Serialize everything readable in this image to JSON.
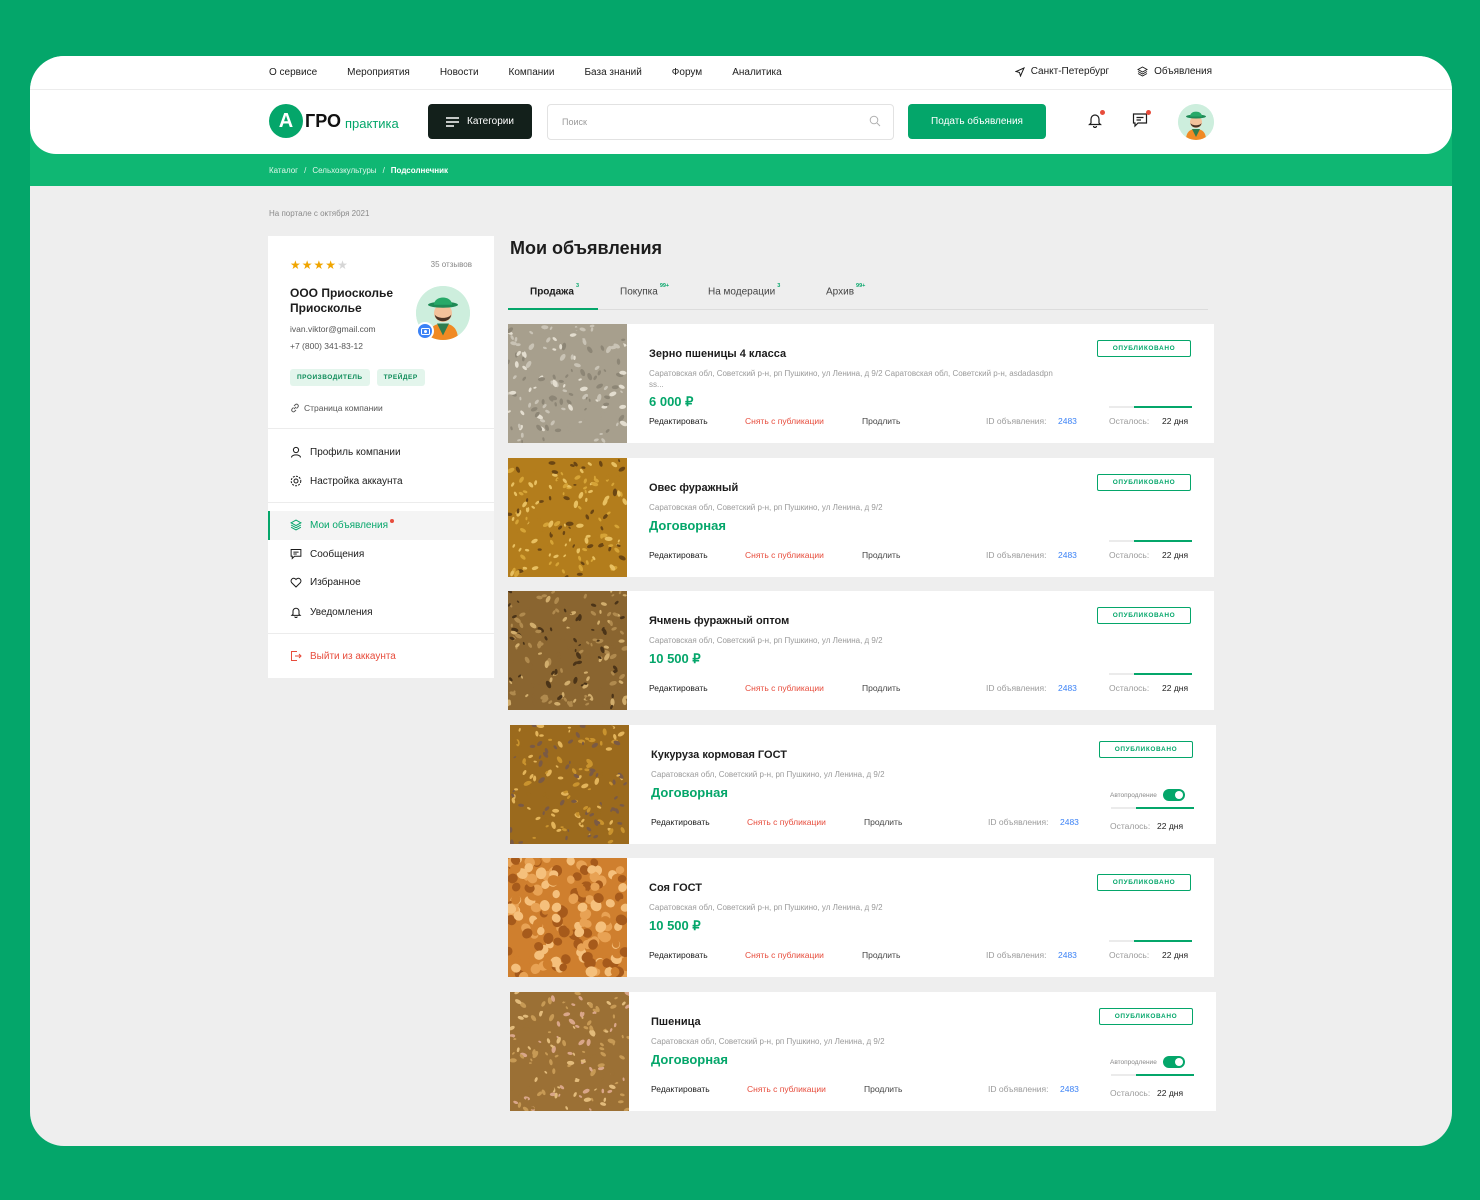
{
  "topnav": [
    "О сервисе",
    "Мероприятия",
    "Новости",
    "Компании",
    "База знаний",
    "Форум",
    "Аналитика"
  ],
  "topright": {
    "city": "Санкт-Петербург",
    "ads": "Объявления"
  },
  "logo": {
    "mark": "А",
    "main": "ГРО",
    "sub": "практика"
  },
  "header": {
    "categories_label": "Категории",
    "search_placeholder": "Поиск",
    "post_label": "Подать объявления"
  },
  "breadcrumb": [
    "Каталог",
    "Сельхозкультуры",
    "Подсолнечник"
  ],
  "since": "На портале с октября 2021",
  "profile": {
    "rating": 4,
    "reviews": "35 отзывов",
    "company": "ООО Приосколье Приосколье",
    "email": "ivan.viktor@gmail.com",
    "phone": "+7 (800) 341-83-12",
    "tags": [
      "ПРОИЗВОДИТЕЛЬ",
      "ТРЕЙДЕР"
    ],
    "company_link": "Страница компании"
  },
  "menu": {
    "profile": "Профиль компании",
    "settings": "Настройка аккаунта",
    "ads": "Мои объявления",
    "messages": "Сообщения",
    "favorites": "Избранное",
    "notifications": "Уведомления",
    "logout": "Выйти из аккаунта"
  },
  "main": {
    "title": "Мои объявления",
    "tabs": [
      {
        "label": "Продажа",
        "count": "3"
      },
      {
        "label": "Покупка",
        "count": "99+"
      },
      {
        "label": "На модерации",
        "count": "3"
      },
      {
        "label": "Архив",
        "count": "99+"
      }
    ]
  },
  "card_labels": {
    "edit": "Редактировать",
    "unpublish": "Снять с публикации",
    "extend": "Продлить",
    "id_label": "ID объявления:",
    "left_label": "Осталось:",
    "status": "ОПУБЛИКОВАНО",
    "autorenew": "Автопродление"
  },
  "listings": [
    {
      "name": "Зерно пшеницы 4 класса",
      "address": "Саратовская обл, Советский р-н, рп Пушкино, ул Ленина, д 9/2 Саратовская обл, Советский р-н, asdadasdpn ss...",
      "price": "6 000 ₽",
      "id": "2483",
      "left": "22 дня",
      "progress": 0.7,
      "autorenew": false
    },
    {
      "name": "Овес фуражный",
      "address": "Саратовская обл, Советский р-н, рп Пушкино, ул Ленина, д 9/2",
      "price": "Договорная",
      "id": "2483",
      "left": "22 дня",
      "progress": 0.7,
      "autorenew": false
    },
    {
      "name": "Ячмень фуражный оптом",
      "address": "Саратовская обл, Советский р-н, рп Пушкино, ул Ленина, д 9/2",
      "price": "10 500 ₽",
      "id": "2483",
      "left": "22 дня",
      "progress": 0.7,
      "autorenew": false
    },
    {
      "name": "Кукуруза кормовая ГОСТ",
      "address": "Саратовская обл, Советский р-н, рп Пушкино, ул Ленина, д 9/2",
      "price": "Договорная",
      "id": "2483",
      "left": "22 дня",
      "progress": 0.7,
      "autorenew": true
    },
    {
      "name": "Соя ГОСТ",
      "address": "Саратовская обл, Советский р-н, рп Пушкино, ул Ленина, д 9/2",
      "price": "10 500 ₽",
      "id": "2483",
      "left": "22 дня",
      "progress": 0.7,
      "autorenew": false
    },
    {
      "name": "Пшеница",
      "address": "Саратовская обл, Советский р-н, рп Пушкино, ул Ленина, д 9/2",
      "price": "Договорная",
      "id": "2483",
      "left": "22 дня",
      "progress": 0.7,
      "autorenew": true
    }
  ],
  "colors": {
    "brand": "#04a66a",
    "dark": "#13201b",
    "danger": "#e74c3c",
    "link": "#3b82f6"
  }
}
